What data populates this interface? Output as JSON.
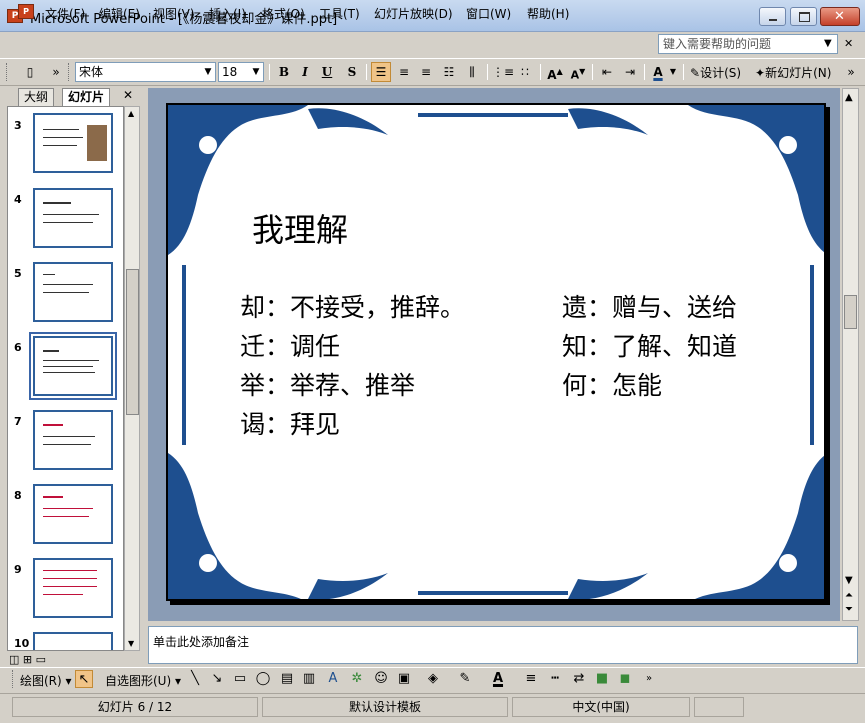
{
  "window": {
    "title": "Microsoft PowerPoint - [《杨震暮夜却金》课件.ppt]"
  },
  "menu": {
    "items": [
      "文件(F)",
      "编辑(E)",
      "视图(V)",
      "插入(I)",
      "格式(O)",
      "工具(T)",
      "幻灯片放映(D)",
      "窗口(W)",
      "帮助(H)"
    ],
    "help_placeholder": "键入需要帮助的问题"
  },
  "toolbar": {
    "font_name": "宋体",
    "font_size": "18",
    "bold": "B",
    "italic": "I",
    "underline": "U",
    "shadow": "S",
    "design_label": "设计(S)",
    "new_slide_label": "新幻灯片(N)"
  },
  "left_pane": {
    "tab_outline": "大纲",
    "tab_slides": "幻灯片",
    "slide_numbers": [
      "3",
      "4",
      "5",
      "6",
      "7",
      "8",
      "9",
      "10"
    ],
    "selected_slide": "6"
  },
  "slide": {
    "title": "我理解",
    "left_lines": [
      "却：不接受，推辞。",
      "迁：调任",
      "举：举荐、推举",
      "谒：拜见"
    ],
    "right_lines": [
      "遗：赠与、送给",
      "知：了解、知道",
      "何：怎能"
    ]
  },
  "notes": {
    "placeholder": "单击此处添加备注"
  },
  "drawing_toolbar": {
    "draw_label": "绘图(R)",
    "autoshapes_label": "自选图形(U)"
  },
  "status": {
    "slide_position": "幻灯片 6 / 12",
    "template": "默认设计模板",
    "language": "中文(中国)"
  },
  "colors": {
    "border_blue": "#1e4f8f",
    "accent_red": "#c0103a"
  }
}
